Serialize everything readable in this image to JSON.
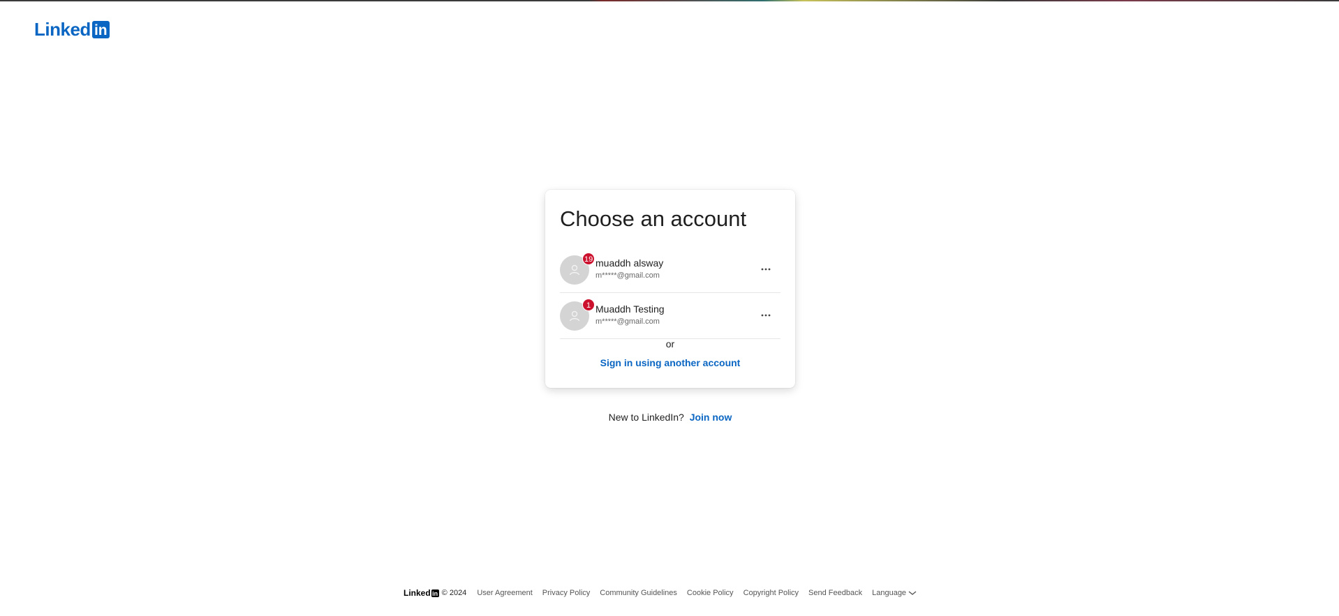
{
  "brand": {
    "logo_word": "Linked",
    "logo_box": "in",
    "color": "#0a66c2"
  },
  "card": {
    "title": "Choose an account",
    "accounts": [
      {
        "name": "muaddh alsway",
        "email": "m*****@gmail.com",
        "badge": "19",
        "avatar_icon": "person-icon",
        "menu_icon": "more-horizontal-icon"
      },
      {
        "name": "Muaddh Testing",
        "email": "m*****@gmail.com",
        "badge": "1",
        "avatar_icon": "person-icon",
        "menu_icon": "more-horizontal-icon"
      }
    ],
    "or_text": "or",
    "signin_other": "Sign in using another account"
  },
  "signup": {
    "prompt": "New to LinkedIn?",
    "join_label": "Join now"
  },
  "footer": {
    "logo_word": "Linked",
    "logo_box": "in",
    "copyright": "© 2024",
    "links": [
      "User Agreement",
      "Privacy Policy",
      "Community Guidelines",
      "Cookie Policy",
      "Copyright Policy",
      "Send Feedback"
    ],
    "language_label": "Language",
    "language_icon": "chevron-down-icon"
  },
  "colors": {
    "accent": "#0a66c2",
    "badge": "#cb112d"
  }
}
